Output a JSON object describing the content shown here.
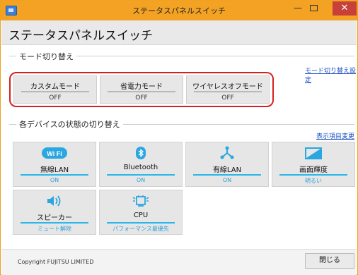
{
  "window": {
    "title": "ステータスパネルスイッチ"
  },
  "header": {
    "title": "ステータスパネルスイッチ"
  },
  "mode_section": {
    "label": "モード切り替え",
    "settings_link": "モード切り替え設定",
    "modes": [
      {
        "label": "カスタムモード",
        "value": "OFF"
      },
      {
        "label": "省電力モード",
        "value": "OFF"
      },
      {
        "label": "ワイヤレスオフモード",
        "value": "OFF"
      }
    ]
  },
  "device_section": {
    "label": "各デバイスの状態の切り替え",
    "change_link": "表示項目変更",
    "tiles": [
      {
        "label": "無線LAN",
        "value": "ON",
        "icon": "wifi-icon"
      },
      {
        "label": "Bluetooth",
        "value": "ON",
        "icon": "bluetooth-icon"
      },
      {
        "label": "有線LAN",
        "value": "ON",
        "icon": "wired-lan-icon"
      },
      {
        "label": "画面輝度",
        "value": "明るい",
        "icon": "brightness-icon"
      },
      {
        "label": "スピーカー",
        "value": "ミュート解除",
        "icon": "speaker-icon"
      },
      {
        "label": "CPU",
        "value": "パフォーマンス最優先",
        "icon": "cpu-icon"
      }
    ]
  },
  "footer": {
    "copyright": "Copyright FUJITSU LIMITED",
    "close_label": "閉じる"
  },
  "icons": {
    "wifi_badge": "Wi Fi"
  },
  "colors": {
    "accent": "#2bb7ea",
    "titlebar": "#f3a224",
    "highlight": "#d62020",
    "close": "#c7403a"
  }
}
